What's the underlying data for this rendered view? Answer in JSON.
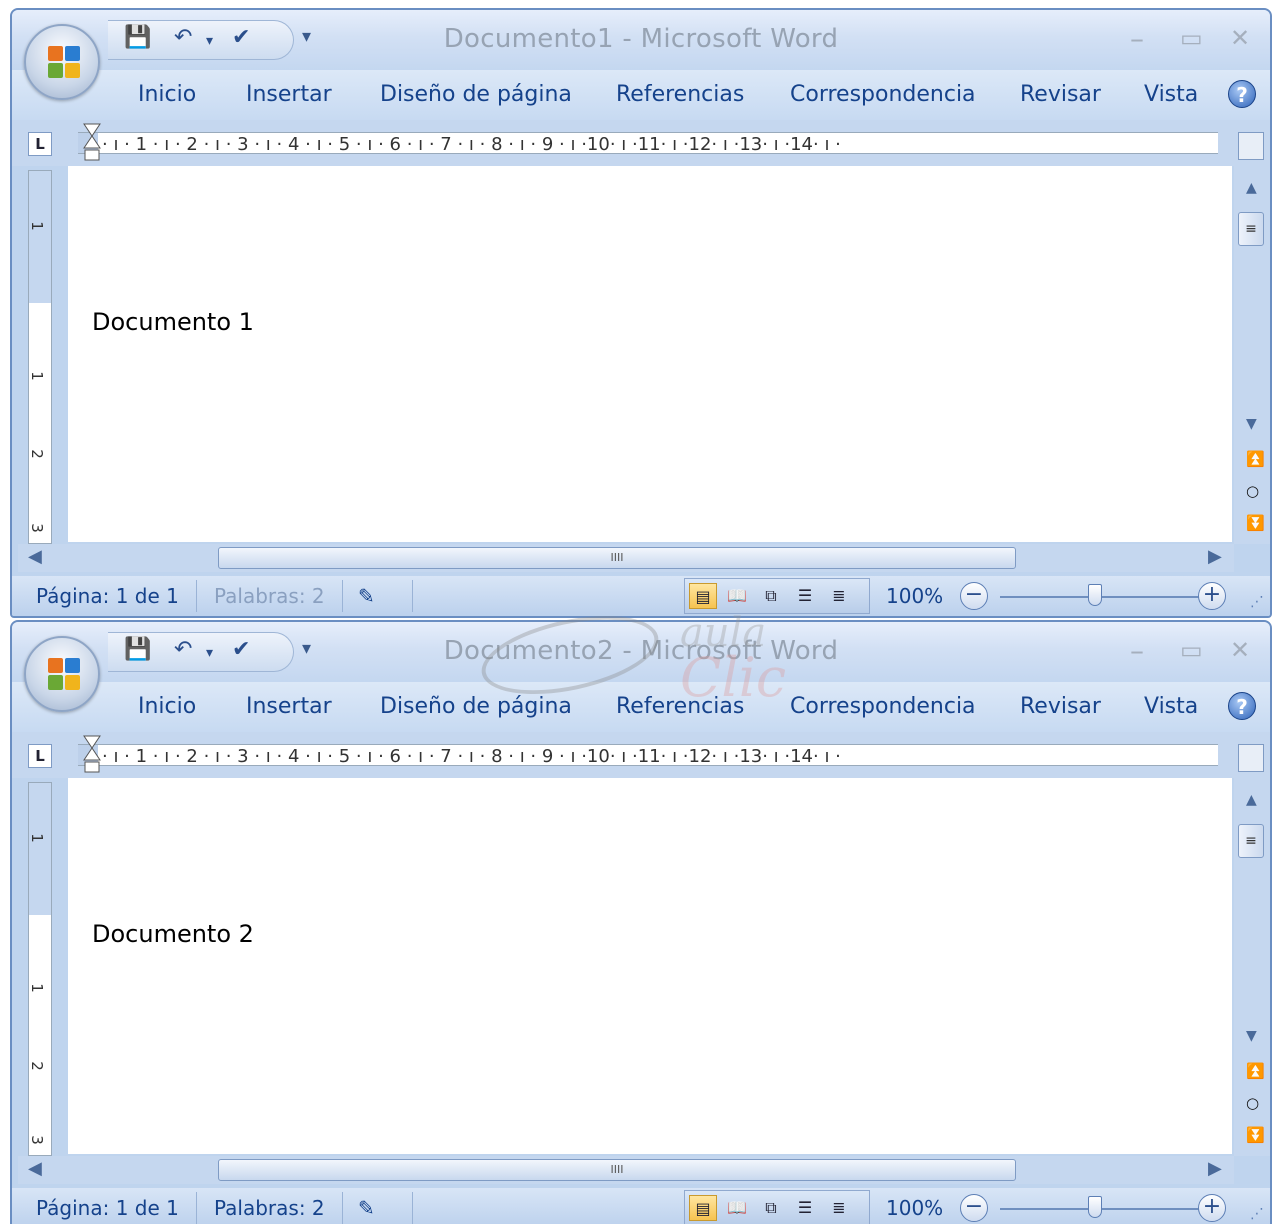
{
  "windows": [
    {
      "title": "Documento1 - Microsoft Word",
      "tabs": [
        "Inicio",
        "Insertar",
        "Diseño de página",
        "Referencias",
        "Correspondencia",
        "Revisar",
        "Vista"
      ],
      "ruler_numbers": "· ı · 1 · ı · 2 · ı · 3 · ı · 4 · ı · 5 · ı · 6 · ı · 7 · ı · 8 · ı · 9 · ı ·10· ı ·11· ı ·12· ı ·13· ı ·14· ı ·",
      "vruler_labels": [
        "1",
        "1",
        "2",
        "3"
      ],
      "doc_text": "Documento 1",
      "status": {
        "page": "Página: 1 de 1",
        "words": "Palabras: 2",
        "zoom": "100%"
      },
      "active": false
    },
    {
      "title": "Documento2 - Microsoft Word",
      "tabs": [
        "Inicio",
        "Insertar",
        "Diseño de página",
        "Referencias",
        "Correspondencia",
        "Revisar",
        "Vista"
      ],
      "ruler_numbers": "· ı · 1 · ı · 2 · ı · 3 · ı · 4 · ı · 5 · ı · 6 · ı · 7 · ı · 8 · ı · 9 · ı ·10· ı ·11· ı ·12· ı ·13· ı ·14· ı ·",
      "vruler_labels": [
        "1",
        "1",
        "2",
        "3"
      ],
      "doc_text": "Documento 2",
      "status": {
        "page": "Página: 1 de 1",
        "words": "Palabras: 2",
        "zoom": "100%"
      },
      "active": true
    }
  ],
  "icons": {
    "save": "save-icon",
    "undo": "undo-icon",
    "spell": "spellcheck-icon",
    "minimize": "minimize-icon",
    "maximize": "maximize-icon",
    "close": "close-icon",
    "help": "help-icon"
  },
  "glyphs": {
    "qat_more": "▾",
    "undo_dropdown": "▾",
    "minimize": "–",
    "maximize": "▭",
    "close": "✕",
    "help": "?",
    "scroll_up": "▲",
    "scroll_down": "▼",
    "scroll_left": "◀",
    "scroll_right": "▶",
    "prev_page": "⏫",
    "browse": "○",
    "next_page": "⏬",
    "zoom_out": "−",
    "zoom_in": "+",
    "grip": "⋰",
    "thumb_grip": "IIII",
    "vthumb_grip": "≡"
  },
  "watermark": {
    "line1": "aula",
    "line2": "Clic"
  }
}
